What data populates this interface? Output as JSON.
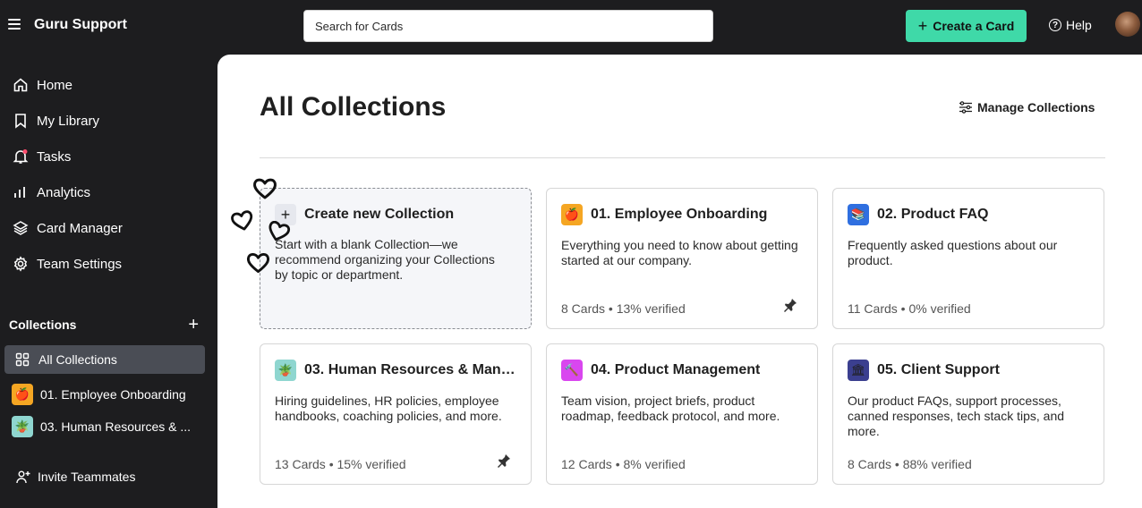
{
  "header": {
    "app_title": "Guru Support",
    "search_placeholder": "Search for Cards",
    "create_label": "Create a Card",
    "help_label": "Help"
  },
  "sidebar": {
    "nav": [
      {
        "label": "Home",
        "icon": "home-icon"
      },
      {
        "label": "My Library",
        "icon": "bookmark-icon"
      },
      {
        "label": "Tasks",
        "icon": "bell-icon"
      },
      {
        "label": "Analytics",
        "icon": "bar-chart-icon"
      },
      {
        "label": "Card Manager",
        "icon": "layers-icon"
      },
      {
        "label": "Team Settings",
        "icon": "gear-icon"
      }
    ],
    "collections_heading": "Collections",
    "collections": [
      {
        "label": "All Collections",
        "icon": "grid-icon",
        "active": true
      },
      {
        "label": "01. Employee Onboarding",
        "icon": "apple-icon",
        "icon_bg": "#f5a623"
      },
      {
        "label": "03. Human Resources & ...",
        "icon": "plant-icon",
        "icon_bg": "#8fd6d0"
      }
    ],
    "invite_label": "Invite Teammates"
  },
  "main": {
    "title": "All Collections",
    "manage_label": "Manage Collections",
    "new_collection": {
      "title": "Create new Collection",
      "desc": "Start with a blank Collection—we recommend organizing your Collections by topic or department."
    },
    "cards": [
      {
        "title": "01. Employee Onboarding",
        "desc": "Everything you need to know about getting started at our company.",
        "meta": "8 Cards • 13% verified",
        "icon": "apple-icon",
        "icon_bg": "#f5a623",
        "pinned": true
      },
      {
        "title": "02. Product FAQ",
        "desc": "Frequently asked questions about our product.",
        "meta": "11 Cards • 0% verified",
        "icon": "books-icon",
        "icon_bg": "#2f6fe0",
        "pinned": false
      },
      {
        "title": "03. Human Resources & Mana...",
        "desc": "Hiring guidelines, HR policies, employee handbooks, coaching policies, and more.",
        "meta": "13 Cards • 15% verified",
        "icon": "plant-icon",
        "icon_bg": "#8fd6d0",
        "pinned": true
      },
      {
        "title": "04. Product Management",
        "desc": "Team vision, project briefs, product roadmap, feedback protocol, and more.",
        "meta": "12 Cards • 8% verified",
        "icon": "tools-icon",
        "icon_bg": "#d946ef",
        "pinned": false
      },
      {
        "title": "05. Client Support",
        "desc": "Our product FAQs, support processes, canned responses, tech stack tips, and more.",
        "meta": "8 Cards • 88% verified",
        "icon": "building-icon",
        "icon_bg": "#3b3f8f",
        "pinned": false
      }
    ]
  },
  "colors": {
    "accent": "#3fd9a8",
    "background_dark": "#1d1d1f",
    "active_item": "#4a4d55"
  }
}
